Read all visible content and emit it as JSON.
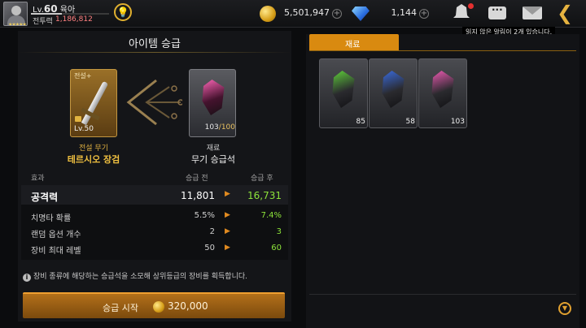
{
  "player": {
    "level_prefix": "Lv.",
    "level": "60",
    "name": "육아",
    "combat_power_label": "전투력",
    "combat_power": "1,186,812",
    "level_progress": 0.4
  },
  "currency": {
    "gold": "5,501,947",
    "gems": "1,144"
  },
  "notification": {
    "message": "읽지 않은 알림이 2개 있습니다."
  },
  "upgrade": {
    "title": "아이템 승급",
    "weapon": {
      "tag": "전설+",
      "level": "Lv.50",
      "type": "전설 무기",
      "name": "테르시오 장검"
    },
    "stone": {
      "count": "103",
      "required": "/100",
      "type": "재료",
      "name": "무기 승급석"
    },
    "table_headers": {
      "effect": "효과",
      "before": "승급 전",
      "after": "승급 후"
    },
    "stats": [
      {
        "name": "공격력",
        "before": "11,801",
        "after": "16,731"
      },
      {
        "name": "치명타 확률",
        "before": "5.5%",
        "after": "7.4%"
      },
      {
        "name": "랜덤 옵션 개수",
        "before": "2",
        "after": "3"
      },
      {
        "name": "장비 최대 레벨",
        "before": "50",
        "after": "60"
      }
    ],
    "info_text": "장비 종류에 해당하는 승급석을 소모해 상위등급의 장비를 획득합니다.",
    "button_label": "승급 시작",
    "cost": "320,000"
  },
  "materials": {
    "tab_label": "재료",
    "items": [
      {
        "qty": "85",
        "color": "#5fd13a"
      },
      {
        "qty": "58",
        "color": "#3a6ce0"
      },
      {
        "qty": "103",
        "color": "#f05ab4"
      }
    ]
  }
}
